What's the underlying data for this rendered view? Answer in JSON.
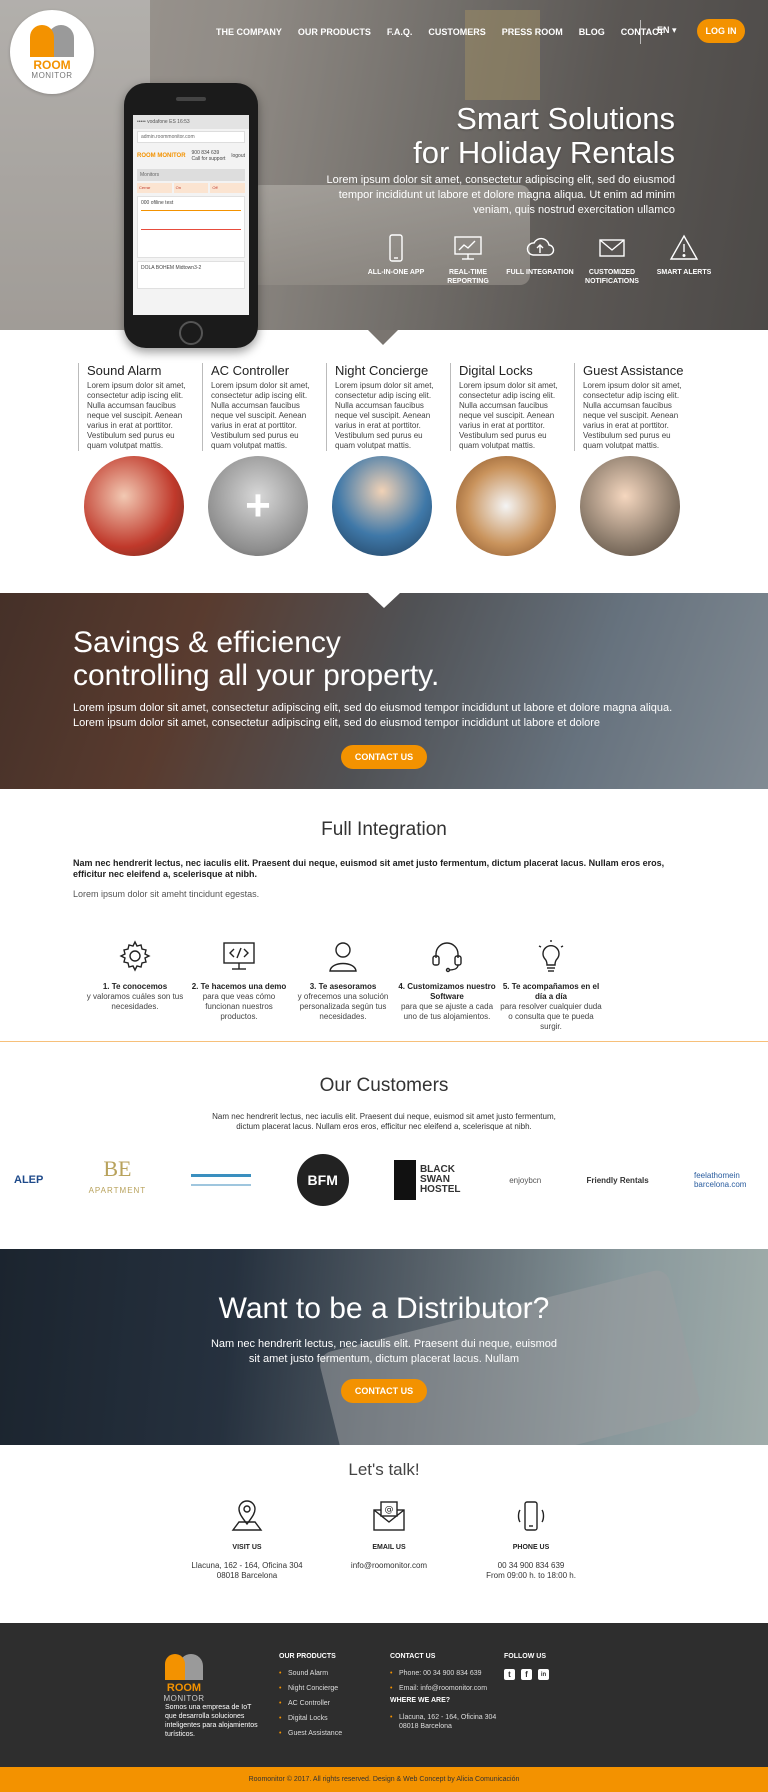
{
  "brand": {
    "line1": "ROOM",
    "line2": "MONITOR"
  },
  "nav": {
    "items": [
      "THE COMPANY",
      "OUR PRODUCTS",
      "F.A.Q.",
      "CUSTOMERS",
      "PRESS ROOM",
      "BLOG",
      "CONTACT"
    ],
    "lang": "EN ▾",
    "login": "LOG IN"
  },
  "phone": {
    "status": "••••• vodafone ES  16:53",
    "url": "admin.roommonitor.com",
    "brand": "ROOM MONITOR",
    "phone_number": "900 834 639",
    "support": "Call for support",
    "logout": "logout",
    "tab": "Monitors",
    "row": [
      "Cerrar",
      "On",
      "Off"
    ],
    "card_title": "000 ofiline test",
    "card2_title": "DOLA BOHEM Midtown3-2"
  },
  "hero": {
    "title_line1": "Smart Solutions",
    "title_line2": "for Holiday Rentals",
    "subtitle": "Lorem ipsum dolor sit amet, consectetur adipiscing elit, sed do eiusmod tempor incididunt ut labore et dolore magna aliqua. Ut enim ad minim veniam, quis nostrud exercitation ullamco",
    "features": [
      {
        "icon": "smartphone-icon",
        "label": "ALL-IN-ONE APP"
      },
      {
        "icon": "monitor-chart-icon",
        "label": "REAL-TIME REPORTING"
      },
      {
        "icon": "cloud-upload-icon",
        "label": "FULL INTEGRATION"
      },
      {
        "icon": "envelope-icon",
        "label": "CUSTOMIZED NOTIFICATIONS"
      },
      {
        "icon": "warning-icon",
        "label": "SMART ALERTS"
      }
    ]
  },
  "services": [
    {
      "title": "Sound Alarm",
      "text": "Lorem ipsum dolor sit amet, consectetur adip iscing elit. Nulla accumsan faucibus neque vel suscipit. Aenean varius in erat at porttitor. Vestibulum sed purus eu quam volutpat mattis."
    },
    {
      "title": "AC Controller",
      "text": "Lorem ipsum dolor sit amet, consectetur adip iscing elit. Nulla accumsan faucibus neque vel suscipit. Aenean varius in erat at porttitor. Vestibulum sed purus eu quam volutpat mattis."
    },
    {
      "title": "Night Concierge",
      "text": "Lorem ipsum dolor sit amet, consectetur adip iscing elit. Nulla accumsan faucibus neque vel suscipit. Aenean varius in erat at porttitor. Vestibulum sed purus eu quam volutpat mattis."
    },
    {
      "title": "Digital Locks",
      "text": "Lorem ipsum dolor sit amet, consectetur adip iscing elit. Nulla accumsan faucibus neque vel suscipit. Aenean varius in erat at porttitor. Vestibulum sed purus eu quam volutpat mattis."
    },
    {
      "title": "Guest Assistance",
      "text": "Lorem ipsum dolor sit amet, consectetur adip iscing elit. Nulla accumsan faucibus neque vel suscipit. Aenean varius in erat at porttitor. Vestibulum sed purus eu quam volutpat mattis."
    }
  ],
  "ac_plus": "+",
  "savings": {
    "title_line1": "Savings & efficiency",
    "title_line2": "controlling all your property.",
    "text": "Lorem ipsum dolor sit amet, consectetur adipiscing elit, sed do eiusmod tempor incididunt ut labore et dolore magna aliqua. Lorem ipsum dolor sit amet, consectetur adipiscing elit, sed do eiusmod tempor incididunt ut labore et dolore",
    "button": "CONTACT US"
  },
  "integration": {
    "title": "Full Integration",
    "bold_text": "Nam nec hendrerit lectus, nec iaculis elit. Praesent dui neque, euismod sit amet justo fermentum, dictum placerat lacus. Nullam eros eros, efficitur nec eleifend a, scelerisque at nibh.",
    "light_text": "Lorem ipsum dolor sit ameht tincidunt egestas.",
    "steps": [
      {
        "icon": "gear-icon",
        "title": "1. Te conocemos",
        "text": "y valoramos cuáles son tus necesidades."
      },
      {
        "icon": "code-monitor-icon",
        "title": "2. Te hacemos una demo",
        "text": "para que veas cómo funcionan nuestros productos."
      },
      {
        "icon": "user-icon",
        "title": "3. Te asesoramos",
        "text": "y ofrecemos una solución personalizada según tus necesidades."
      },
      {
        "icon": "headset-icon",
        "title": "4. Customizamos nuestro Software",
        "text": "para que se ajuste a cada uno de tus alojamientos."
      },
      {
        "icon": "lightbulb-icon",
        "title": "5. Te acompañamos en el día a día",
        "text": "para resolver cualquier duda o consulta que te pueda surgir."
      }
    ]
  },
  "customers": {
    "title": "Our Customers",
    "text": "Nam nec hendrerit lectus, nec iaculis elit. Praesent dui neque, euismod sit amet justo fermentum, dictum placerat lacus. Nullam eros eros, efficitur nec eleifend a, scelerisque at nibh.",
    "logos": {
      "alep": "ALEP",
      "be_mark": "BE",
      "be_text": "APARTMENT",
      "third": "",
      "bfm": "BFM",
      "black_swan": "BLACK SWAN HOSTEL",
      "enjoy": "enjoybcn",
      "friendly": "Friendly Rentals",
      "feelathome": "feelathomein barcelona.com"
    }
  },
  "distributor": {
    "title": "Want to be a Distributor?",
    "text": "Nam nec hendrerit lectus, nec iaculis elit. Praesent dui neque, euismod sit amet justo fermentum, dictum placerat lacus. Nullam",
    "button": "CONTACT US"
  },
  "contact": {
    "title": "Let's talk!",
    "items": [
      {
        "icon": "map-pin-icon",
        "heading": "VISIT US",
        "line1": "Llacuna, 162 - 164, Oficina 304",
        "line2": "08018 Barcelona"
      },
      {
        "icon": "email-icon",
        "heading": "EMAIL US",
        "line1": "info@roomonitor.com",
        "line2": ""
      },
      {
        "icon": "phone-icon",
        "heading": "PHONE US",
        "line1": "00 34 900 834 639",
        "line2": "From 09:00 h. to 18:00 h."
      }
    ]
  },
  "footer": {
    "description": "Somos una empresa de IoT que desarrolla soluciones inteligentes para alojamientos turísticos.",
    "products_heading": "OUR PRODUCTS",
    "products": [
      "Sound Alarm",
      "Night Concierge",
      "AC Controller",
      "Digital Locks",
      "Guest Assistance"
    ],
    "contact_heading": "CONTACT US",
    "contact": [
      "Phone: 00 34 900 834 639",
      "Email: info@roomonitor.com"
    ],
    "where_heading": "WHERE WE ARE?",
    "where": [
      "Llacuna, 162 - 164, Oficina 304 08018 Barcelona"
    ],
    "follow_heading": "FOLLOW US",
    "social": [
      {
        "icon": "twitter-icon",
        "glyph": "t"
      },
      {
        "icon": "facebook-icon",
        "glyph": "f"
      },
      {
        "icon": "linkedin-icon",
        "glyph": "in"
      }
    ],
    "copyright": "Roomonitor © 2017. All rights reserved. Design & Web Concept by Alicia Comunicación"
  }
}
